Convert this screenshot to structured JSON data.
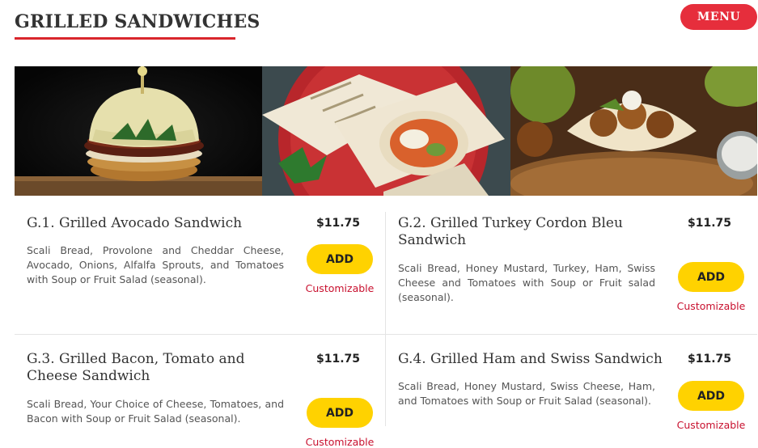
{
  "header": {
    "title": "GRILLED SANDWICHES",
    "menu_label": "MENU"
  },
  "banner": {
    "images": [
      {
        "name": "avocado-burger-photo"
      },
      {
        "name": "grilled-wrap-photo"
      },
      {
        "name": "falafel-pita-photo"
      }
    ]
  },
  "items": [
    {
      "name": "G.1. Grilled Avocado Sandwich",
      "price": "$11.75",
      "description": "Scali Bread, Provolone and Cheddar Cheese, Avocado, Onions, Alfalfa Sprouts, and Tomatoes with Soup or Fruit Salad (seasonal).",
      "add_label": "ADD",
      "tag": "Customizable"
    },
    {
      "name": "G.2. Grilled Turkey Cordon Bleu Sandwich",
      "price": "$11.75",
      "description": "Scali Bread, Honey Mustard, Turkey, Ham, Swiss Cheese and Tomatoes with Soup or Fruit salad (seasonal).",
      "add_label": "ADD",
      "tag": "Customizable"
    },
    {
      "name": "G.3. Grilled Bacon, Tomato and Cheese Sandwich",
      "price": "$11.75",
      "description": "Scali Bread, Your Choice of Cheese, Tomatoes, and Bacon with Soup or Fruit Salad (seasonal).",
      "add_label": "ADD",
      "tag": "Customizable"
    },
    {
      "name": "G.4. Grilled Ham and Swiss Sandwich",
      "price": "$11.75",
      "description": "Scali Bread, Honey Mustard, Swiss Cheese, Ham, and Tomatoes with Soup or Fruit Salad (seasonal).",
      "add_label": "ADD",
      "tag": "Customizable"
    }
  ],
  "colors": {
    "accent_red": "#e62e3c",
    "add_yellow": "#ffd200",
    "custom_red": "#c8102e"
  }
}
